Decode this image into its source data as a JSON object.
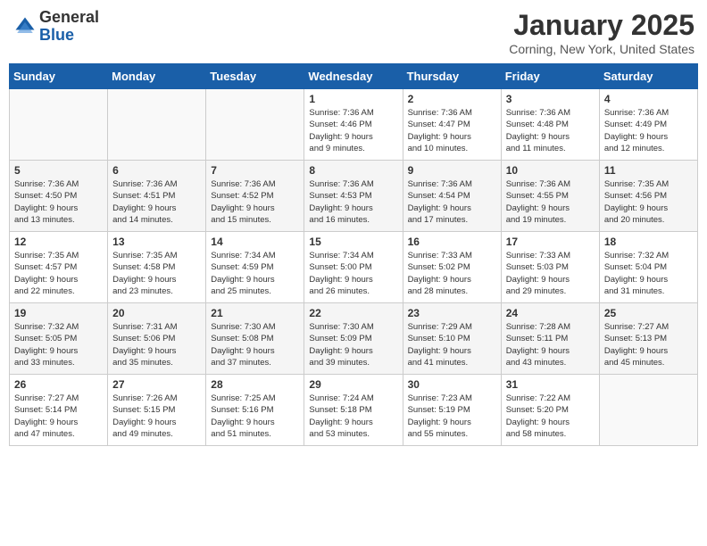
{
  "header": {
    "logo_general": "General",
    "logo_blue": "Blue",
    "month_title": "January 2025",
    "location": "Corning, New York, United States"
  },
  "weekdays": [
    "Sunday",
    "Monday",
    "Tuesday",
    "Wednesday",
    "Thursday",
    "Friday",
    "Saturday"
  ],
  "weeks": [
    [
      {
        "day": "",
        "info": ""
      },
      {
        "day": "",
        "info": ""
      },
      {
        "day": "",
        "info": ""
      },
      {
        "day": "1",
        "info": "Sunrise: 7:36 AM\nSunset: 4:46 PM\nDaylight: 9 hours\nand 9 minutes."
      },
      {
        "day": "2",
        "info": "Sunrise: 7:36 AM\nSunset: 4:47 PM\nDaylight: 9 hours\nand 10 minutes."
      },
      {
        "day": "3",
        "info": "Sunrise: 7:36 AM\nSunset: 4:48 PM\nDaylight: 9 hours\nand 11 minutes."
      },
      {
        "day": "4",
        "info": "Sunrise: 7:36 AM\nSunset: 4:49 PM\nDaylight: 9 hours\nand 12 minutes."
      }
    ],
    [
      {
        "day": "5",
        "info": "Sunrise: 7:36 AM\nSunset: 4:50 PM\nDaylight: 9 hours\nand 13 minutes."
      },
      {
        "day": "6",
        "info": "Sunrise: 7:36 AM\nSunset: 4:51 PM\nDaylight: 9 hours\nand 14 minutes."
      },
      {
        "day": "7",
        "info": "Sunrise: 7:36 AM\nSunset: 4:52 PM\nDaylight: 9 hours\nand 15 minutes."
      },
      {
        "day": "8",
        "info": "Sunrise: 7:36 AM\nSunset: 4:53 PM\nDaylight: 9 hours\nand 16 minutes."
      },
      {
        "day": "9",
        "info": "Sunrise: 7:36 AM\nSunset: 4:54 PM\nDaylight: 9 hours\nand 17 minutes."
      },
      {
        "day": "10",
        "info": "Sunrise: 7:36 AM\nSunset: 4:55 PM\nDaylight: 9 hours\nand 19 minutes."
      },
      {
        "day": "11",
        "info": "Sunrise: 7:35 AM\nSunset: 4:56 PM\nDaylight: 9 hours\nand 20 minutes."
      }
    ],
    [
      {
        "day": "12",
        "info": "Sunrise: 7:35 AM\nSunset: 4:57 PM\nDaylight: 9 hours\nand 22 minutes."
      },
      {
        "day": "13",
        "info": "Sunrise: 7:35 AM\nSunset: 4:58 PM\nDaylight: 9 hours\nand 23 minutes."
      },
      {
        "day": "14",
        "info": "Sunrise: 7:34 AM\nSunset: 4:59 PM\nDaylight: 9 hours\nand 25 minutes."
      },
      {
        "day": "15",
        "info": "Sunrise: 7:34 AM\nSunset: 5:00 PM\nDaylight: 9 hours\nand 26 minutes."
      },
      {
        "day": "16",
        "info": "Sunrise: 7:33 AM\nSunset: 5:02 PM\nDaylight: 9 hours\nand 28 minutes."
      },
      {
        "day": "17",
        "info": "Sunrise: 7:33 AM\nSunset: 5:03 PM\nDaylight: 9 hours\nand 29 minutes."
      },
      {
        "day": "18",
        "info": "Sunrise: 7:32 AM\nSunset: 5:04 PM\nDaylight: 9 hours\nand 31 minutes."
      }
    ],
    [
      {
        "day": "19",
        "info": "Sunrise: 7:32 AM\nSunset: 5:05 PM\nDaylight: 9 hours\nand 33 minutes."
      },
      {
        "day": "20",
        "info": "Sunrise: 7:31 AM\nSunset: 5:06 PM\nDaylight: 9 hours\nand 35 minutes."
      },
      {
        "day": "21",
        "info": "Sunrise: 7:30 AM\nSunset: 5:08 PM\nDaylight: 9 hours\nand 37 minutes."
      },
      {
        "day": "22",
        "info": "Sunrise: 7:30 AM\nSunset: 5:09 PM\nDaylight: 9 hours\nand 39 minutes."
      },
      {
        "day": "23",
        "info": "Sunrise: 7:29 AM\nSunset: 5:10 PM\nDaylight: 9 hours\nand 41 minutes."
      },
      {
        "day": "24",
        "info": "Sunrise: 7:28 AM\nSunset: 5:11 PM\nDaylight: 9 hours\nand 43 minutes."
      },
      {
        "day": "25",
        "info": "Sunrise: 7:27 AM\nSunset: 5:13 PM\nDaylight: 9 hours\nand 45 minutes."
      }
    ],
    [
      {
        "day": "26",
        "info": "Sunrise: 7:27 AM\nSunset: 5:14 PM\nDaylight: 9 hours\nand 47 minutes."
      },
      {
        "day": "27",
        "info": "Sunrise: 7:26 AM\nSunset: 5:15 PM\nDaylight: 9 hours\nand 49 minutes."
      },
      {
        "day": "28",
        "info": "Sunrise: 7:25 AM\nSunset: 5:16 PM\nDaylight: 9 hours\nand 51 minutes."
      },
      {
        "day": "29",
        "info": "Sunrise: 7:24 AM\nSunset: 5:18 PM\nDaylight: 9 hours\nand 53 minutes."
      },
      {
        "day": "30",
        "info": "Sunrise: 7:23 AM\nSunset: 5:19 PM\nDaylight: 9 hours\nand 55 minutes."
      },
      {
        "day": "31",
        "info": "Sunrise: 7:22 AM\nSunset: 5:20 PM\nDaylight: 9 hours\nand 58 minutes."
      },
      {
        "day": "",
        "info": ""
      }
    ]
  ]
}
